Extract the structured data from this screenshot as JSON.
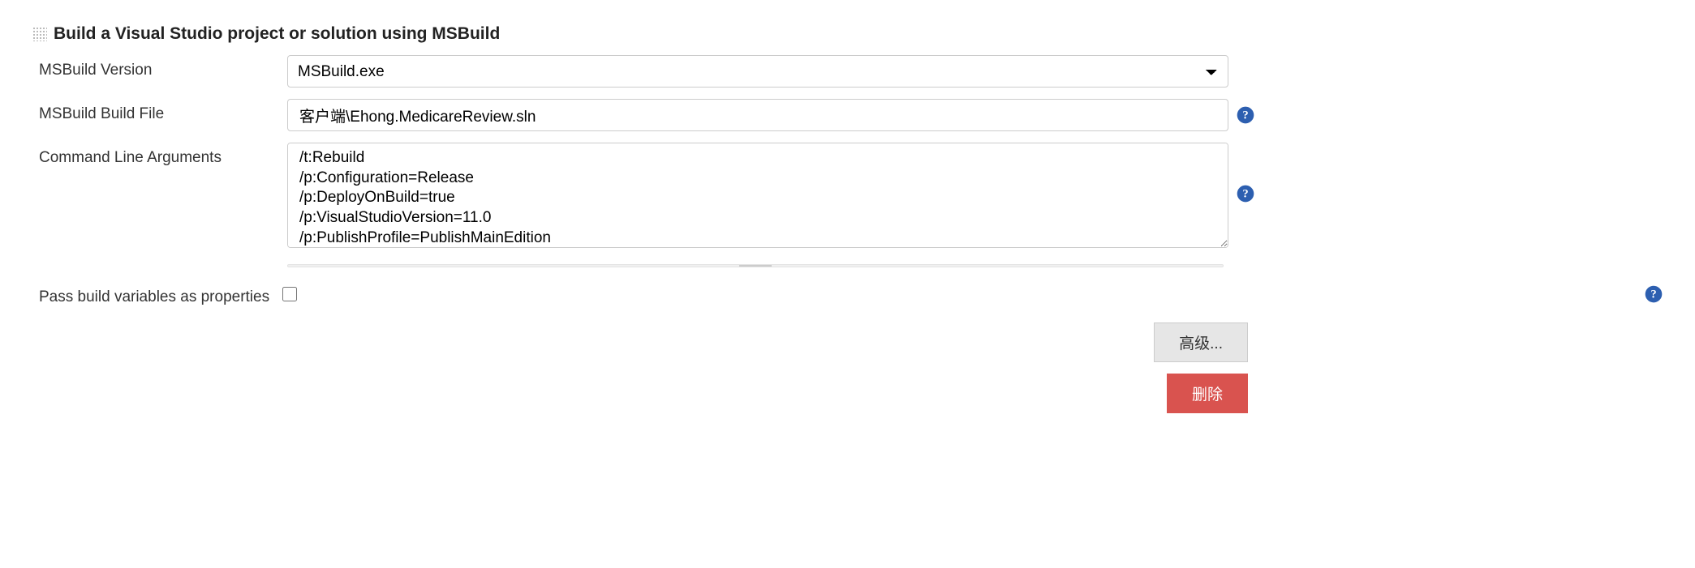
{
  "section": {
    "title": "Build a Visual Studio project or solution using MSBuild"
  },
  "fields": {
    "msbuild_version": {
      "label": "MSBuild Version",
      "selected": "MSBuild.exe"
    },
    "build_file": {
      "label": "MSBuild Build File",
      "value": "客户端\\Ehong.MedicareReview.sln"
    },
    "cmd_args": {
      "label": "Command Line Arguments",
      "value": "/t:Rebuild\n/p:Configuration=Release\n/p:DeployOnBuild=true\n/p:VisualStudioVersion=11.0\n/p:PublishProfile=PublishMainEdition"
    },
    "pass_vars": {
      "label": "Pass build variables as properties",
      "checked": false
    }
  },
  "buttons": {
    "advanced": "高级...",
    "delete": "删除"
  }
}
